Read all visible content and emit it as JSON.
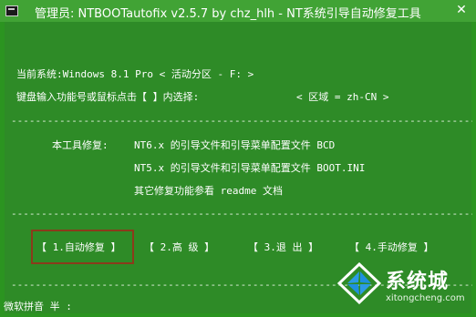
{
  "window": {
    "title": "管理员:  NTBOOTautofix v2.5.7 by chz_hlh - NT系统引导自动修复工具",
    "close_glyph": "✕"
  },
  "console": {
    "system_line": "当前系统:Windows 8.1 Pro  < 活动分区 - F: >",
    "prompt_line": "键盘输入功能号或鼠标点击【 】内选择:",
    "locale_line": "< 区域 = zh-CN >",
    "separator": "------------------------------------------------------------------------------------------",
    "repair_label": "本工具修复:",
    "repair_nt6": "NT6.x 的引导文件和引导菜单配置文件 BCD",
    "repair_nt5": "NT5.x 的引导文件和引导菜单配置文件 BOOT.INI",
    "repair_other": "其它修复功能参看 readme 文档",
    "ime_status": "微软拼音 半 :"
  },
  "menu": {
    "items": [
      {
        "label": "【 1.自动修复 】",
        "selected": true
      },
      {
        "label": "【  2.高  级  】",
        "selected": false
      },
      {
        "label": "【  3.退  出  】",
        "selected": false
      },
      {
        "label": "【 4.手动修复 】",
        "selected": false
      }
    ]
  },
  "watermark": {
    "brand": "系统城",
    "url": "xitongcheng.com"
  },
  "colors": {
    "console_bg": "#2e8b27",
    "titlebar_bg": "#41a335",
    "selection_border": "#8b3b1b",
    "logo_blue": "#1e90e0"
  }
}
